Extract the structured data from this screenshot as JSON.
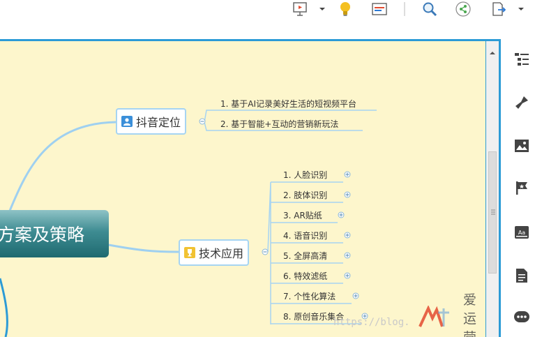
{
  "toolbar": {
    "icons": [
      "presentation-icon",
      "dropdown-arrow-icon",
      "idea-bulb-icon",
      "outline-view-icon",
      "search-icon",
      "share-icon",
      "export-icon",
      "dropdown-arrow-icon"
    ]
  },
  "map": {
    "root": "方案及策略",
    "branch1": {
      "label": "抖音定位",
      "icon": "user-icon",
      "children": [
        "1. 基于AI记录美好生活的短视频平台",
        "2. 基于智能+互动的营销新玩法"
      ]
    },
    "branch2": {
      "label": "技术应用",
      "icon": "trophy-icon",
      "children": [
        "1. 人脸识别",
        "2. 肢体识别",
        "3. AR贴纸",
        "4. 语音识别",
        "5. 全屏高清",
        "6. 特效滤纸",
        "7. 个性化算法",
        "8. 原创音乐集合"
      ]
    }
  },
  "sidebar": {
    "icons": [
      "outline-icon",
      "format-brush-icon",
      "image-icon",
      "flag-icon",
      "text-style-icon",
      "notes-icon",
      "more-icon"
    ]
  },
  "watermark": {
    "url_text": "https://blog.",
    "brand": "爱运营"
  },
  "colors": {
    "canvas_bg": "#fdf6cc",
    "frame": "#2c9bd6",
    "branch_line": "#9fd0f0",
    "root_top": "#8fc3c6",
    "root_bottom": "#1f6a70",
    "accent_red": "#e34a2f"
  }
}
